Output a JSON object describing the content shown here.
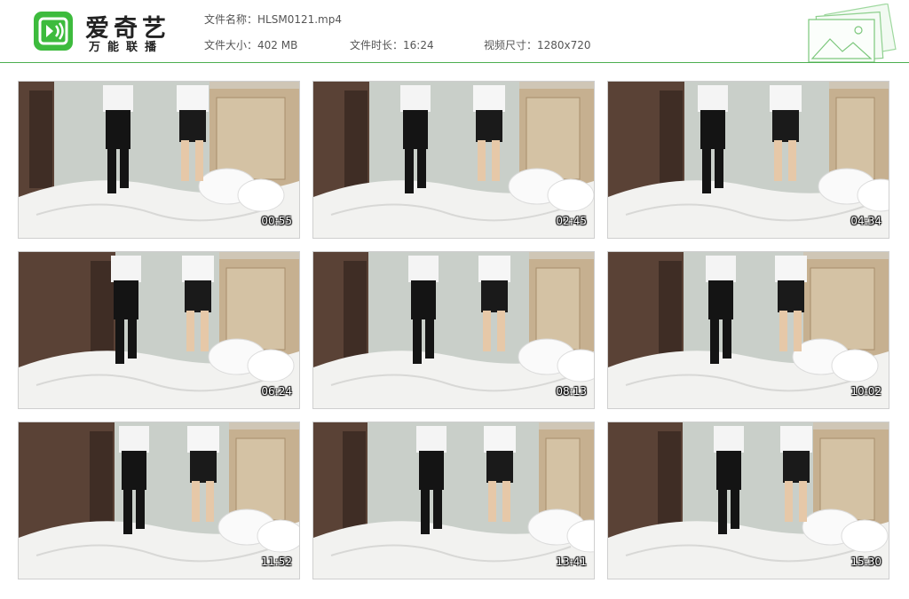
{
  "brand": {
    "name": "爱奇艺",
    "subtitle": "万能联播"
  },
  "file": {
    "name_label": "文件名称：",
    "name_value": "HLSM0121.mp4",
    "size_label": "文件大小：",
    "size_value": "402 MB",
    "duration_label": "文件时长：",
    "duration_value": "16:24",
    "dimensions_label": "视频尺寸：",
    "dimensions_value": "1280x720"
  },
  "thumbnails": [
    {
      "timestamp": "00:55"
    },
    {
      "timestamp": "02:45"
    },
    {
      "timestamp": "04:34"
    },
    {
      "timestamp": "06:24"
    },
    {
      "timestamp": "08:13"
    },
    {
      "timestamp": "10:02"
    },
    {
      "timestamp": "11:52"
    },
    {
      "timestamp": "13:41"
    },
    {
      "timestamp": "15:30"
    }
  ],
  "colors": {
    "accent": "#3dbb3d",
    "divider": "#4caf50"
  }
}
